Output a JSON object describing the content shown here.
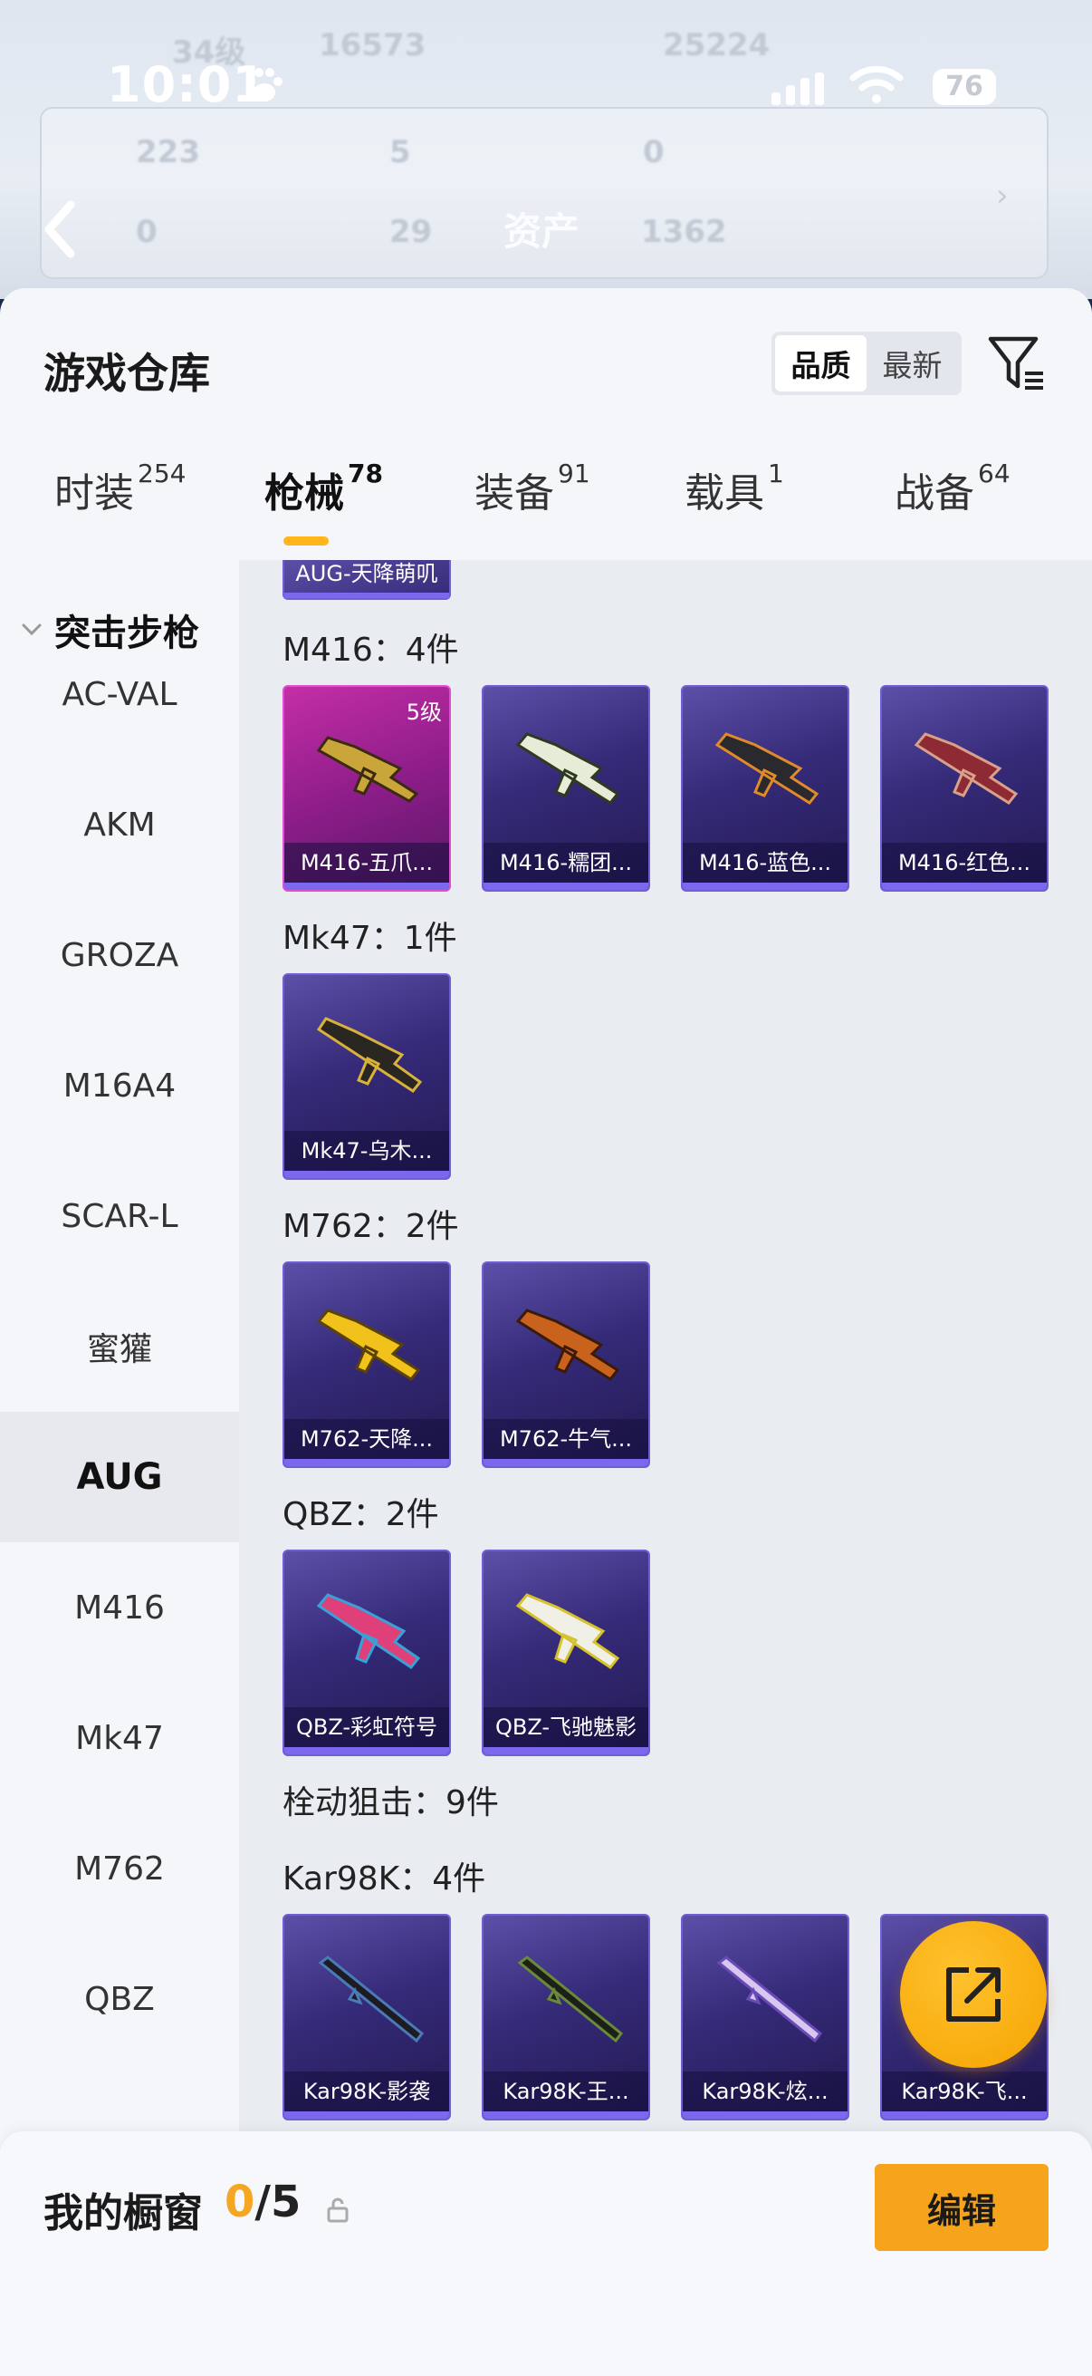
{
  "status_bar": {
    "time": "10:01",
    "battery": "76"
  },
  "background_header": {
    "title": "资产"
  },
  "sheet": {
    "title": "游戏仓库",
    "sort": {
      "options": [
        "品质",
        "最新"
      ],
      "active": "品质"
    },
    "tabs": [
      {
        "label": "时装",
        "count": "254"
      },
      {
        "label": "枪械",
        "count": "78"
      },
      {
        "label": "装备",
        "count": "91"
      },
      {
        "label": "载具",
        "count": "1"
      },
      {
        "label": "战备",
        "count": "64"
      }
    ],
    "active_tab": "枪械"
  },
  "sidebar": {
    "group": "突击步枪",
    "items": [
      "AC-VAL",
      "AKM",
      "GROZA",
      "M16A4",
      "SCAR-L",
      "蜜獾",
      "AUG",
      "M416",
      "Mk47",
      "M762",
      "QBZ"
    ],
    "active": "AUG"
  },
  "content": {
    "partial_item": "AUG-天降萌叽",
    "groups": [
      {
        "label": "M416：4件",
        "items": [
          {
            "name": "M416-五爪...",
            "level": "5级",
            "rarity": "legendary"
          },
          {
            "name": "M416-糯团..."
          },
          {
            "name": "M416-蓝色..."
          },
          {
            "name": "M416-红色..."
          }
        ]
      },
      {
        "label": "Mk47：1件",
        "items": [
          {
            "name": "Mk47-乌木..."
          }
        ]
      },
      {
        "label": "M762：2件",
        "items": [
          {
            "name": "M762-天降..."
          },
          {
            "name": "M762-牛气..."
          }
        ]
      },
      {
        "label": "QBZ：2件",
        "items": [
          {
            "name": "QBZ-彩虹符号"
          },
          {
            "name": "QBZ-飞驰魅影"
          }
        ]
      }
    ],
    "category_label": "栓动狙击：9件",
    "kar_group": {
      "label": "Kar98K：4件",
      "items": [
        {
          "name": "Kar98K-影袭"
        },
        {
          "name": "Kar98K-王..."
        },
        {
          "name": "Kar98K-炫..."
        },
        {
          "name": "Kar98K-飞..."
        }
      ]
    }
  },
  "bottom_bar": {
    "label": "我的橱窗",
    "current": "0",
    "total": "/5",
    "edit_label": "编辑"
  },
  "colors": {
    "accent": "#f6a41c",
    "card_purple": "#352a78",
    "card_pink": "#8e1d8a",
    "tab_underline": "#ffb51b"
  },
  "icons": {
    "filter": "filter-icon",
    "fab": "share-external-icon",
    "lock": "lock-icon",
    "back": "back-chevron-icon"
  }
}
